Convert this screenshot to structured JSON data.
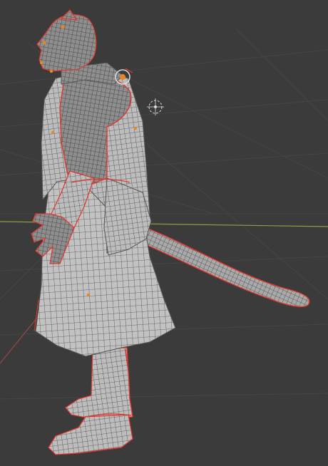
{
  "viewport": {
    "shading": "wireframe-overlay",
    "object_type": "character-mesh",
    "colors": {
      "background": "#3b3b3b",
      "grid_line": "#454545",
      "x_axis": "#86a340",
      "y_axis": "#9c4a44",
      "mesh_fill": "#bdbdbd",
      "mesh_wire": "#4a4a4a",
      "seam": "#e2362c",
      "vertex_point": "#e8862a",
      "cursor": "#dcdcdc"
    },
    "icons": [
      "3d-cursor-icon",
      "object-origin-icon",
      "light-gizmo-icon"
    ]
  }
}
